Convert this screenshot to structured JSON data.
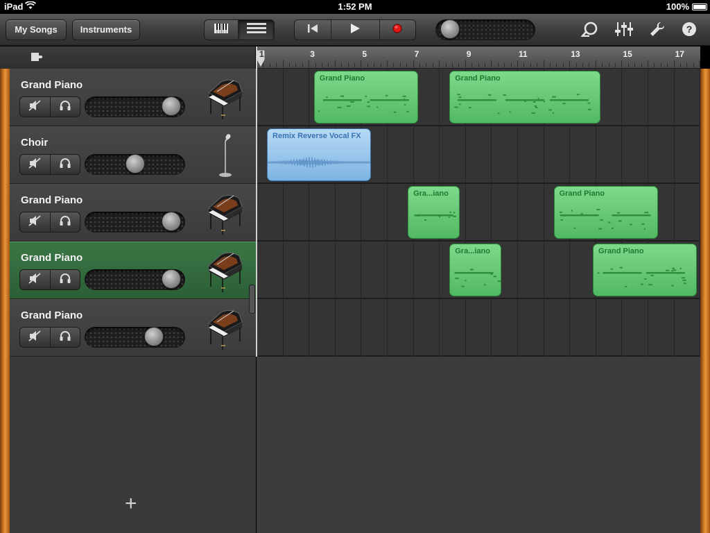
{
  "status": {
    "device": "iPad",
    "time": "1:52 PM",
    "battery": "100%"
  },
  "toolbar": {
    "my_songs": "My Songs",
    "instruments": "Instruments",
    "view_active": "tracks",
    "master_volume": 0.05
  },
  "ruler": {
    "labels": [
      "1",
      "3",
      "5",
      "7",
      "9",
      "11",
      "13",
      "15",
      "17"
    ]
  },
  "tracks": [
    {
      "name": "Grand Piano",
      "instrument": "grand-piano-icon",
      "volume": 0.96,
      "selected": false
    },
    {
      "name": "Choir",
      "instrument": "microphone-icon",
      "volume": 0.5,
      "selected": false
    },
    {
      "name": "Grand Piano",
      "instrument": "grand-piano-icon",
      "volume": 0.96,
      "selected": false
    },
    {
      "name": "Grand Piano",
      "instrument": "grand-piano-icon",
      "volume": 0.96,
      "selected": true
    },
    {
      "name": "Grand Piano",
      "instrument": "grand-piano-icon",
      "volume": 0.74,
      "selected": false
    }
  ],
  "regions": [
    {
      "track": 0,
      "label": "Grand Piano",
      "start_bar": 3.2,
      "end_bar": 7.2,
      "kind": "midi"
    },
    {
      "track": 0,
      "label": "Grand Piano",
      "start_bar": 8.4,
      "end_bar": 14.2,
      "kind": "midi"
    },
    {
      "track": 1,
      "label": "Remix Reverse Vocal FX",
      "start_bar": 1.4,
      "end_bar": 5.4,
      "kind": "audio"
    },
    {
      "track": 2,
      "label": "Gra...iano",
      "start_bar": 6.8,
      "end_bar": 8.8,
      "kind": "midi"
    },
    {
      "track": 2,
      "label": "Grand Piano",
      "start_bar": 12.4,
      "end_bar": 16.4,
      "kind": "midi"
    },
    {
      "track": 3,
      "label": "Gra...iano",
      "start_bar": 8.4,
      "end_bar": 10.4,
      "kind": "midi"
    },
    {
      "track": 3,
      "label": "Grand Piano",
      "start_bar": 13.9,
      "end_bar": 17.9,
      "kind": "midi"
    }
  ],
  "add_track_symbol": "+",
  "colors": {
    "midi_region": "#6ccb7a",
    "audio_region": "#9cc9ee",
    "selected_track": "#347043",
    "wood": "#d07a24"
  }
}
